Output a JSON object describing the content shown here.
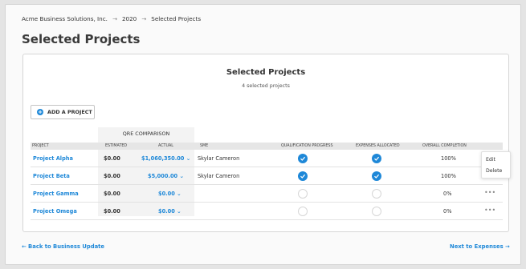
{
  "breadcrumb": {
    "items": [
      "Acme Business Solutions, Inc.",
      "2020",
      "Selected Projects"
    ],
    "separator": "→"
  },
  "page_title": "Selected Projects",
  "card": {
    "title": "Selected Projects",
    "subtitle": "4 selected projects",
    "add_button_label": "ADD A PROJECT"
  },
  "table": {
    "group_header": "QRE COMPARISON",
    "columns": {
      "project": "PROJECT",
      "estimated": "ESTIMATED",
      "actual": "ACTUAL",
      "sme": "SME",
      "qualification": "QUALIFICATION PROGRESS",
      "expenses": "EXPENSES ALLOCATED",
      "completion": "OVERALL COMPLETION"
    },
    "rows": [
      {
        "project": "Project Alpha",
        "estimated": "$0.00",
        "actual": "$1,060,350.00",
        "sme": "Skylar Cameron",
        "qualification_done": true,
        "expenses_done": true,
        "completion": "100%"
      },
      {
        "project": "Project Beta",
        "estimated": "$0.00",
        "actual": "$5,000.00",
        "sme": "Skylar Cameron",
        "qualification_done": true,
        "expenses_done": true,
        "completion": "100%"
      },
      {
        "project": "Project Gamma",
        "estimated": "$0.00",
        "actual": "$0.00",
        "sme": "",
        "qualification_done": false,
        "expenses_done": false,
        "completion": "0%"
      },
      {
        "project": "Project Omega",
        "estimated": "$0.00",
        "actual": "$0.00",
        "sme": "",
        "qualification_done": false,
        "expenses_done": false,
        "completion": "0%"
      }
    ],
    "dropdown_glyph": "⌄",
    "more_glyph": "•••"
  },
  "context_menu": {
    "items": [
      "Edit",
      "Delete"
    ]
  },
  "footer": {
    "back_label": "← Back to Business Update",
    "next_label": "Next to Expenses →"
  },
  "colors": {
    "accent": "#1e88d8",
    "page_bg": "#fafafa",
    "band_bg": "#f3f3f3"
  }
}
